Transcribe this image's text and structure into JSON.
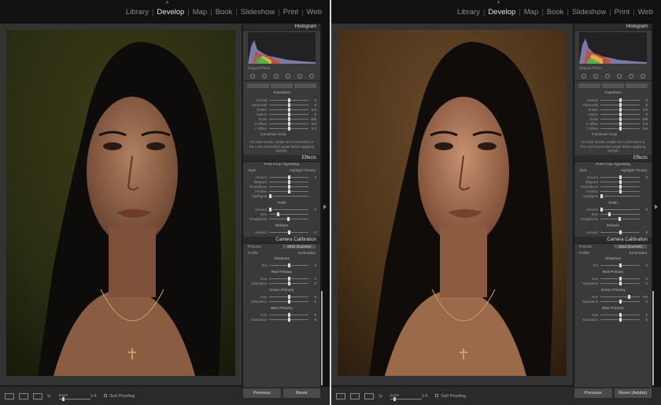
{
  "modules": [
    "Library",
    "Develop",
    "Map",
    "Book",
    "Slideshow",
    "Print",
    "Web"
  ],
  "active_module": "Develop",
  "panels": {
    "histogram": "Histogram",
    "original_photo": "Original Photo",
    "transform_title": "Transform",
    "transform_sliders": [
      {
        "label": "Vertical",
        "value": "0"
      },
      {
        "label": "Horizontal",
        "value": "0"
      },
      {
        "label": "Rotate",
        "value": "0.0"
      },
      {
        "label": "Aspect",
        "value": "0"
      },
      {
        "label": "Scale",
        "value": "100"
      },
      {
        "label": "X Offset",
        "value": "0.0"
      },
      {
        "label": "Y Offset",
        "value": "0.0"
      }
    ],
    "constrain_crop": "Constrain Crop",
    "lens_note": "For best results, enable lens corrections in the Lens Corrections panel before applying Upright.",
    "effects": "Effects",
    "vignetting_title": "Post-Crop Vignetting",
    "style_label": "Style",
    "style_value": "Highlight Priority",
    "vignetting_sliders": [
      {
        "label": "Amount",
        "value": "0"
      },
      {
        "label": "Midpoint",
        "value": ""
      },
      {
        "label": "Roundness",
        "value": ""
      },
      {
        "label": "Feather",
        "value": ""
      },
      {
        "label": "Highlights",
        "value": ""
      }
    ],
    "grain_title": "Grain",
    "grain_sliders": [
      {
        "label": "Amount",
        "value": "0"
      },
      {
        "label": "Size",
        "value": ""
      },
      {
        "label": "Roughness",
        "value": ""
      }
    ],
    "dehaze_title": "Dehaze",
    "dehaze_sliders": [
      {
        "label": "Amount",
        "value": "0"
      }
    ],
    "calibration": "Camera Calibration",
    "process_label": "Process",
    "process_value": "2012 (Current)",
    "profile_label": "Profile",
    "profile_value": "Embedded",
    "shadows_title": "Shadows",
    "shadows_sliders": [
      {
        "label": "Tint",
        "value": "0"
      }
    ],
    "red_title": "Red Primary",
    "red_sliders": [
      {
        "label": "Hue",
        "value": "0"
      },
      {
        "label": "Saturation",
        "value": "0"
      }
    ],
    "green_title": "Green Primary",
    "blue_title": "Blue Primary",
    "blue_sliders": [
      {
        "label": "Hue",
        "value": "0"
      },
      {
        "label": "Saturation",
        "value": "0"
      }
    ]
  },
  "left": {
    "green_sliders": [
      {
        "label": "Hue",
        "value": "0"
      },
      {
        "label": "Saturation",
        "value": "0"
      }
    ],
    "previous": "Previous",
    "reset": "Reset"
  },
  "right": {
    "green_sliders": [
      {
        "label": "Hue",
        "value": "+40"
      },
      {
        "label": "Saturation",
        "value": "0"
      }
    ],
    "previous": "Previous",
    "reset": "Reset (Adobe)"
  },
  "toolbar": {
    "zoom_label": "Zoom",
    "zoom_value": "1:4",
    "soft_proofing": "Soft Proofing"
  }
}
